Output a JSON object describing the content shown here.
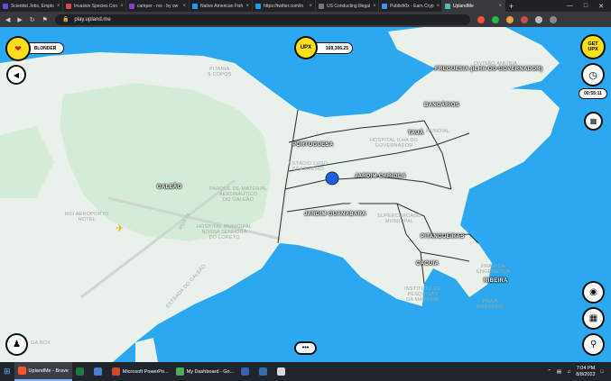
{
  "tabs": [
    {
      "title": "Scientist Jobs, Emplo",
      "color": "#6a4bd6",
      "active": false
    },
    {
      "title": "Invasive Species Con",
      "color": "#d24a4a",
      "active": false
    },
    {
      "title": "camper - rvs - by ow",
      "color": "#8a3fc8",
      "active": false
    },
    {
      "title": "Native American Fish",
      "color": "#1d9bf0",
      "active": false
    },
    {
      "title": "https://twitter.com/in",
      "color": "#1d9bf0",
      "active": false
    },
    {
      "title": "US Conducting Illegal",
      "color": "#777777",
      "active": false
    },
    {
      "title": "Publish0x - Earn Cryp",
      "color": "#4a90e2",
      "active": false
    },
    {
      "title": "UplandMe",
      "color": "#4bc0b5",
      "active": true
    }
  ],
  "browser": {
    "url": "play.upland.me",
    "new_tab": "+"
  },
  "hud": {
    "player_name": "BLONDER",
    "upx_label": "UPX",
    "upx_balance": "169,306.25",
    "get_upx": "GET\nUPX",
    "timer": "00:55:11"
  },
  "neighborhoods": [
    "FREGUESIA (ILHA DO GOVERNADOR)",
    "BANCÁRIOS",
    "TAUÁ",
    "PORTUGUESA",
    "JARDIM CARIOCA",
    "GALEÃO",
    "JARDIM GUANABARA",
    "PITANGUEIRAS",
    "CACUIA",
    "RIBEIRA"
  ],
  "places": [
    "PITANIA\nS COPOS",
    "DIVISÃO ANFÍBIA\nNAVAIS",
    "MUNDIAL",
    "HOSPITAL ILHA DO\nGOVERNADOR",
    "ESTÁDIO LUSO\nBRASILEIRO",
    "PARQUE DE MATERIAL\nAERONÁUTICO\nDO GALEÃO",
    "RIO AEROPORTO\nHOTEL",
    "RUA 74",
    "HOSPITAL MUNICIPAL\nNOSSA SENHORA\nDO LORETO",
    "SUPERCERCADO\nMUNICIPAL",
    "ESTRADA DO GALEÃO",
    "INSTITUTO DE\nPESQUISAS\nDA MARINHA",
    "PRAIA DA\nENGENHOCA",
    "PRAIA\nMARTINHO",
    "GA BOX"
  ],
  "taskbar": {
    "items": [
      "UplandMe - Brave",
      "",
      "",
      "Microsoft PowerPo...",
      "My Dashboard - Go...",
      "",
      "",
      ""
    ],
    "time": "7:04 PM",
    "date": "8/8/2022"
  },
  "colors": {
    "water": "#2ba8ef",
    "land": "#eaf1ea",
    "green": "#d4ecd7",
    "accent": "#ffde1a"
  }
}
